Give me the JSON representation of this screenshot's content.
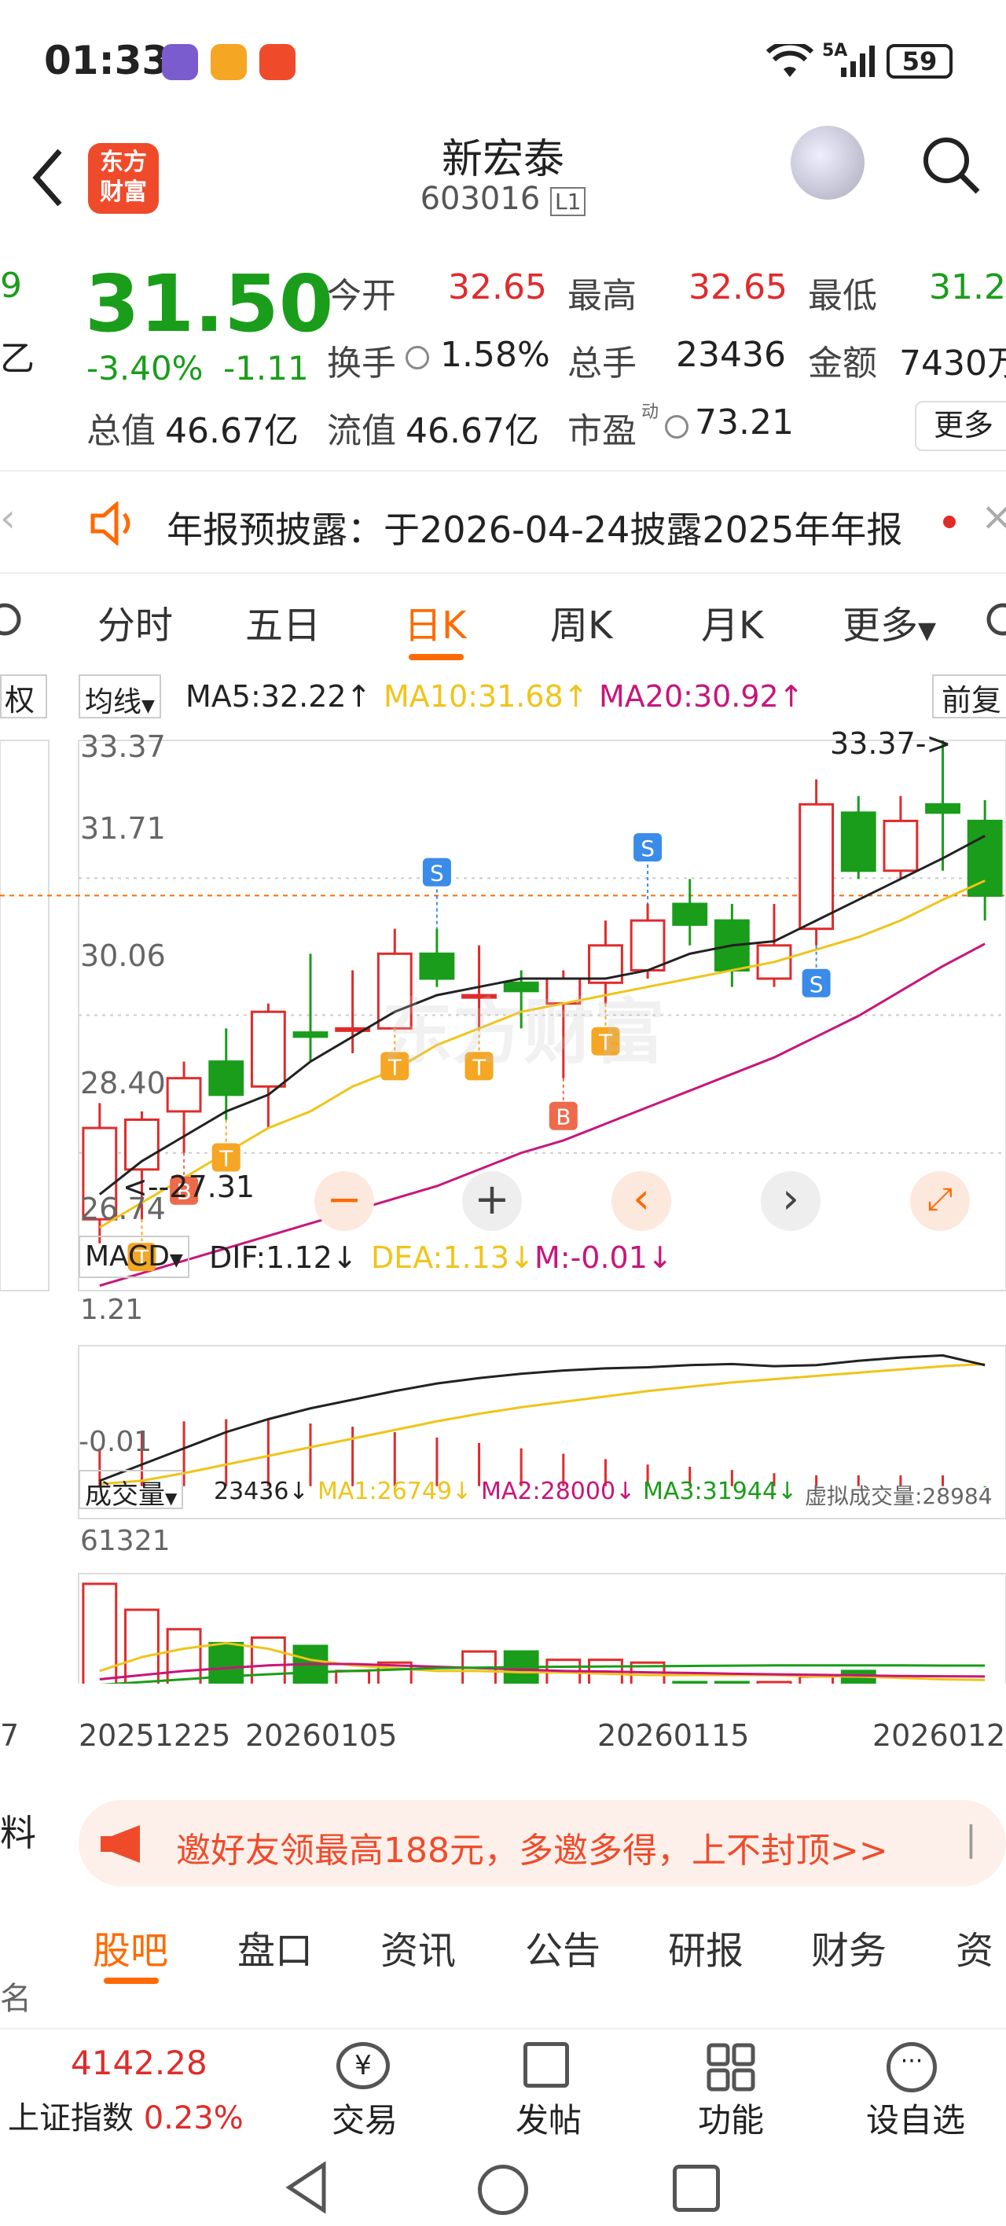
{
  "status": {
    "time": "01:33",
    "network": "5A",
    "battery": "59"
  },
  "header": {
    "stock_name": "新宏泰",
    "stock_code": "603016",
    "level": "L1",
    "logo_line1": "东方",
    "logo_line2": "财富"
  },
  "quote": {
    "price": "31.50",
    "change_pct": "-3.40%",
    "change": "-1.11",
    "left_fragment_1": "9",
    "left_fragment_2": "乙",
    "open_label": "今开",
    "open": "32.65",
    "high_label": "最高",
    "high": "32.65",
    "low_label": "最低",
    "low": "31.2",
    "turnover_label": "换手",
    "turnover": "1.58%",
    "volume_label": "总手",
    "volume": "23436",
    "amount_label": "金额",
    "amount": "7430万",
    "mcap_label": "总值",
    "mcap": "46.67亿",
    "float_label": "流值",
    "float_cap": "46.67亿",
    "pe_label": "市盈",
    "pe_sup": "动",
    "pe": "73.21",
    "more_label": "更多"
  },
  "notice": {
    "text": "年报预披露：于2026-04-24披露2025年年报"
  },
  "tabs": {
    "items": [
      "分时",
      "五日",
      "日K",
      "周K",
      "月K",
      "更多"
    ],
    "active": "日K"
  },
  "colors": {
    "up": "#e02b2b",
    "down": "#1a9d1a",
    "accent": "#ff6a00",
    "ma5": "#222222",
    "ma10": "#f0c419",
    "ma20": "#c8157a"
  },
  "chart_labels": {
    "fuquan": "权",
    "ma_selector": "均线",
    "ma5": "MA5:32.22↑",
    "ma10": "MA10:31.68↑",
    "ma20": "MA20:30.92↑",
    "qianfu": "前复",
    "y_top": "33.37",
    "y_2": "31.71",
    "y_3": "30.06",
    "y_4": "28.40",
    "y_bottom": "26.74",
    "high_mark": "33.37->",
    "low_mark": "<--27.31",
    "macd_selector": "MACD",
    "dif": "DIF:1.12↓",
    "dea": "DEA:1.13↓",
    "m": "M:-0.01↓",
    "macd_top": "1.21",
    "macd_bottom": "-0.01",
    "vol_selector": "成交量",
    "vol_val": "23436↓",
    "ma1": "MA1:26749↓",
    "ma2": "MA2:28000↓",
    "ma3": "MA3:31944↓",
    "virtual": "虚拟成交量:28984",
    "vol_top": "61321",
    "date_1": "20251225",
    "date_2": "20260105",
    "date_3": "20260115",
    "date_4": "2026012",
    "left_partial": "7",
    "left_partial_2": "料",
    "left_partial_3": "名",
    "watermark": "东方财富"
  },
  "chart_data": {
    "type": "candlestick",
    "ylim": [
      26.74,
      33.37
    ],
    "candles": [
      {
        "o": 27.6,
        "c": 28.7,
        "h": 29.0,
        "l": 27.31
      },
      {
        "o": 28.2,
        "c": 28.8,
        "h": 28.9,
        "l": 27.6
      },
      {
        "o": 28.9,
        "c": 29.3,
        "h": 29.5,
        "l": 28.4
      },
      {
        "o": 29.5,
        "c": 29.1,
        "h": 29.9,
        "l": 28.8
      },
      {
        "o": 29.2,
        "c": 30.1,
        "h": 30.2,
        "l": 28.7
      },
      {
        "o": 29.85,
        "c": 29.8,
        "h": 30.8,
        "l": 29.5
      },
      {
        "o": 29.9,
        "c": 29.9,
        "h": 30.6,
        "l": 29.6
      },
      {
        "o": 29.9,
        "c": 30.8,
        "h": 31.1,
        "l": 29.9
      },
      {
        "o": 30.8,
        "c": 30.5,
        "h": 31.1,
        "l": 30.4
      },
      {
        "o": 30.3,
        "c": 30.3,
        "h": 30.9,
        "l": 29.9
      },
      {
        "o": 30.45,
        "c": 30.35,
        "h": 30.6,
        "l": 29.9
      },
      {
        "o": 30.2,
        "c": 30.5,
        "h": 30.6,
        "l": 29.3
      },
      {
        "o": 30.45,
        "c": 30.9,
        "h": 31.2,
        "l": 30.2
      },
      {
        "o": 30.6,
        "c": 31.2,
        "h": 31.4,
        "l": 30.5
      },
      {
        "o": 31.4,
        "c": 31.15,
        "h": 31.7,
        "l": 30.9
      },
      {
        "o": 31.2,
        "c": 30.6,
        "h": 31.4,
        "l": 30.4
      },
      {
        "o": 30.5,
        "c": 30.9,
        "h": 31.4,
        "l": 30.4
      },
      {
        "o": 31.1,
        "c": 32.6,
        "h": 32.9,
        "l": 30.9
      },
      {
        "o": 32.5,
        "c": 31.8,
        "h": 32.7,
        "l": 31.7
      },
      {
        "o": 31.8,
        "c": 32.4,
        "h": 32.7,
        "l": 31.7
      },
      {
        "o": 32.6,
        "c": 32.5,
        "h": 33.37,
        "l": 31.8
      },
      {
        "o": 32.4,
        "c": 31.5,
        "h": 32.65,
        "l": 31.2
      }
    ],
    "ma5": [
      27.9,
      28.3,
      28.6,
      28.9,
      29.1,
      29.5,
      29.8,
      30.1,
      30.3,
      30.4,
      30.5,
      30.5,
      30.5,
      30.6,
      30.8,
      30.9,
      30.95,
      31.2,
      31.45,
      31.7,
      31.95,
      32.22
    ],
    "ma10": [
      27.5,
      27.8,
      28.1,
      28.4,
      28.7,
      28.9,
      29.2,
      29.4,
      29.7,
      29.9,
      30.1,
      30.2,
      30.3,
      30.4,
      30.5,
      30.6,
      30.7,
      30.85,
      31.0,
      31.2,
      31.45,
      31.68
    ],
    "ma20": [
      26.8,
      26.95,
      27.1,
      27.25,
      27.4,
      27.55,
      27.7,
      27.85,
      28.0,
      28.2,
      28.4,
      28.55,
      28.75,
      28.95,
      29.15,
      29.35,
      29.55,
      29.8,
      30.05,
      30.35,
      30.65,
      30.92
    ],
    "macd_dif": [
      0.05,
      0.2,
      0.35,
      0.5,
      0.62,
      0.72,
      0.8,
      0.88,
      0.95,
      1.0,
      1.04,
      1.07,
      1.09,
      1.1,
      1.12,
      1.13,
      1.11,
      1.12,
      1.16,
      1.19,
      1.21,
      1.12
    ],
    "macd_dea": [
      0.02,
      0.05,
      0.12,
      0.2,
      0.28,
      0.36,
      0.44,
      0.52,
      0.6,
      0.67,
      0.73,
      0.78,
      0.83,
      0.88,
      0.92,
      0.96,
      0.99,
      1.02,
      1.05,
      1.08,
      1.11,
      1.13
    ],
    "macd_m": [
      0.35,
      0.5,
      0.6,
      0.62,
      0.62,
      0.58,
      0.55,
      0.5,
      0.45,
      0.4,
      0.35,
      0.3,
      0.25,
      0.2,
      0.18,
      0.15,
      0.12,
      0.1,
      0.1,
      0.1,
      0.1,
      -0.01
    ],
    "volume": [
      61321,
      52000,
      45000,
      40000,
      42000,
      39000,
      30000,
      33000,
      25000,
      37000,
      37000,
      34000,
      34000,
      33000,
      26000,
      26000,
      26000,
      28000,
      30000,
      24000,
      20000,
      23436
    ],
    "vol_ma1": [
      30000,
      35000,
      38000,
      40000,
      38000,
      34000,
      32000,
      31000,
      30000,
      30000,
      29500,
      29500,
      29000,
      28500,
      28500,
      28500,
      28500,
      28000,
      28000,
      27500,
      27000,
      26749
    ],
    "vol_ma2": [
      27000,
      28500,
      30000,
      31000,
      32000,
      32500,
      32500,
      32000,
      31500,
      31000,
      30500,
      30000,
      29800,
      29500,
      29300,
      29000,
      28800,
      28600,
      28400,
      28200,
      28100,
      28000
    ],
    "vol_ma3": [
      25000,
      26000,
      27000,
      28000,
      28800,
      29500,
      30000,
      30500,
      31000,
      31200,
      31400,
      31500,
      31600,
      31700,
      31800,
      31900,
      32000,
      32000,
      32000,
      32000,
      31944,
      31944
    ],
    "bs_marks": [
      {
        "i": 1,
        "t": "T",
        "pos": "below"
      },
      {
        "i": 2,
        "t": "B",
        "pos": "below"
      },
      {
        "i": 3,
        "t": "T",
        "pos": "below"
      },
      {
        "i": 7,
        "t": "T",
        "pos": "below"
      },
      {
        "i": 8,
        "t": "S",
        "pos": "above"
      },
      {
        "i": 9,
        "t": "T",
        "pos": "below"
      },
      {
        "i": 11,
        "t": "B",
        "pos": "below"
      },
      {
        "i": 12,
        "t": "T",
        "pos": "below"
      },
      {
        "i": 13,
        "t": "S",
        "pos": "above"
      },
      {
        "i": 17,
        "t": "S",
        "pos": "below"
      }
    ]
  },
  "banner": {
    "text": "邀好友领最高188元，多邀多得，上不封顶>>"
  },
  "bottom_tabs": {
    "items": [
      "股吧",
      "盘口",
      "资讯",
      "公告",
      "研报",
      "财务",
      "资"
    ]
  },
  "bottom_nav": {
    "index_value": "4142.28",
    "index_name": "上证指数",
    "index_change": "0.23%",
    "trade": "交易",
    "post": "发帖",
    "func": "功能",
    "watch": "设自选"
  }
}
